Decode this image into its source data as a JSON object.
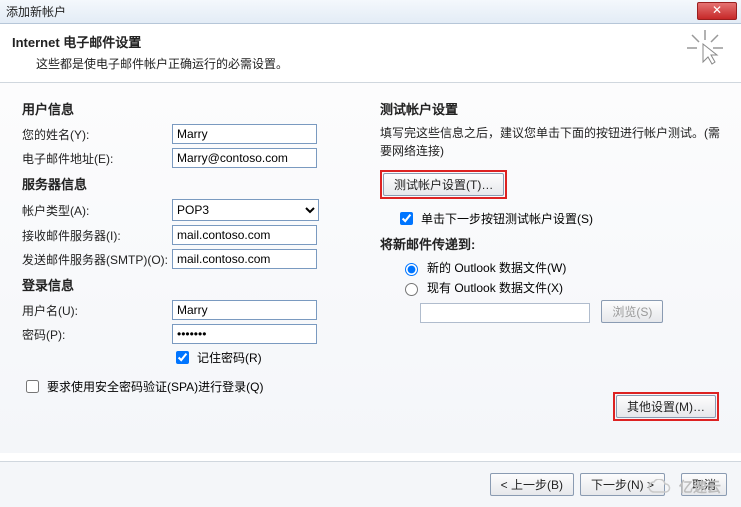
{
  "window": {
    "title": "添加新帐户",
    "close": "✕"
  },
  "header": {
    "title": "Internet 电子邮件设置",
    "subtitle": "这些都是使电子邮件帐户正确运行的必需设置。"
  },
  "user_info": {
    "heading": "用户信息",
    "name_label": "您的姓名(Y):",
    "name_value": "Marry",
    "email_label": "电子邮件地址(E):",
    "email_value": "Marry@contoso.com"
  },
  "server_info": {
    "heading": "服务器信息",
    "type_label": "帐户类型(A):",
    "type_value": "POP3",
    "incoming_label": "接收邮件服务器(I):",
    "incoming_value": "mail.contoso.com",
    "outgoing_label": "发送邮件服务器(SMTP)(O):",
    "outgoing_value": "mail.contoso.com"
  },
  "login_info": {
    "heading": "登录信息",
    "user_label": "用户名(U):",
    "user_value": "Marry",
    "pass_label": "密码(P):",
    "pass_value": "*******",
    "remember_label": "记住密码(R)"
  },
  "spa_label": "要求使用安全密码验证(SPA)进行登录(Q)",
  "test": {
    "heading": "测试帐户设置",
    "desc": "填写完这些信息之后，建议您单击下面的按钮进行帐户测试。(需要网络连接)",
    "button": "测试帐户设置(T)…",
    "checkbox": "单击下一步按钮测试帐户设置(S)"
  },
  "delivery": {
    "heading": "将新邮件传递到:",
    "new_label": "新的 Outlook 数据文件(W)",
    "existing_label": "现有 Outlook 数据文件(X)",
    "browse": "浏览(S)"
  },
  "other_settings": "其他设置(M)…",
  "footer": {
    "back": "< 上一步(B)",
    "next": "下一步(N) >",
    "cancel": "取消"
  },
  "watermark": "亿速云"
}
